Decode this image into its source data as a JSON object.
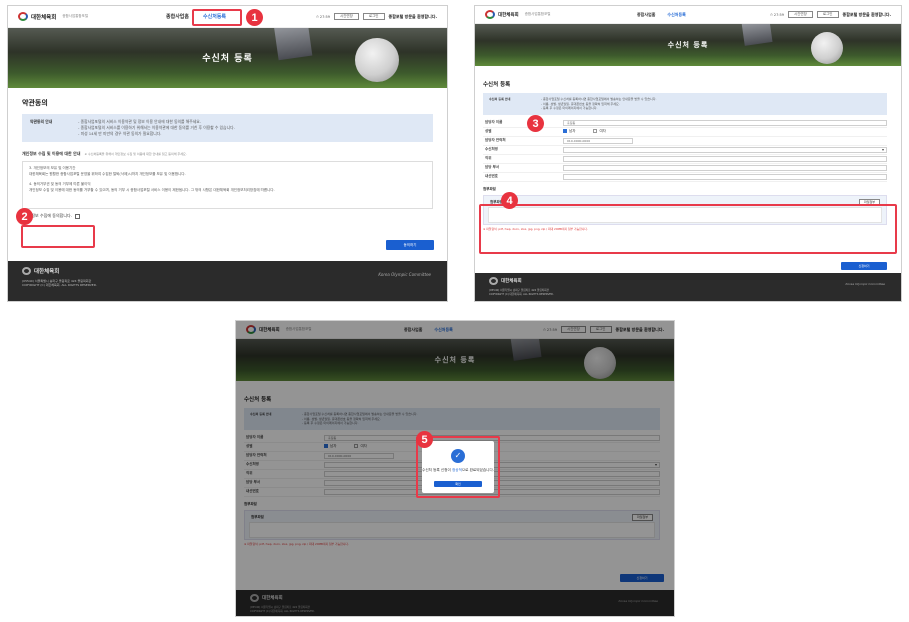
{
  "common": {
    "logo_text": "대한체육회",
    "logo_sub": "종합사업통합포털",
    "nav": [
      "종합사업홈",
      "수신처등록"
    ],
    "util_time": "⏱ 27:59",
    "util_btn1": "시간연장",
    "util_btn2": "로그인",
    "util_greeting": "종합포털 방문을 환영합니다.",
    "hero_title": "수신처 등록",
    "footer_logo": "대한체육회",
    "footer_addr": "(05540) 서울특별시 송파구 올림픽로 424 올림픽회관",
    "footer_copy": "COPYRIGHT (C) 대한체육회. ALL RIGHTS RESERVED.",
    "footer_right": "Korea Olympic Committee"
  },
  "shot1": {
    "section_title": "약관동의",
    "info_label": "약관동의 안내",
    "info_lines": [
      "- 종합사업포털의 서비스 이용약관 및 정보 이용 안내에 대한 동의를 해주세요.",
      "- 종합사업포털의 서비스를 이용하기 위해서는 이용약관에 대한 동의를 거친 후 이용할 수 있습니다.",
      "- 미성 14세 만 미만의 경우 약관 동의가 필요합니다."
    ],
    "privacy_title": "개인정보 수집 및 이용에 대한 안내",
    "privacy_note": "※ 수신처등록을 위해서 개인정보 수집 및 이용에 대한 안내를 읽고 동의해 주세요.",
    "privacy_lines": [
      "3. 개인정보의 보유 및 이용기간",
      "대한체육회는 원활한 종합사업포털 운영을 위하여 수집한 탈퇴(삭제)시까지 개인정보를 보유 및 이용합니다.",
      "",
      "4. 동의거부권 및 동의 거부에 따른 불이익",
      "개인정보 수집 및 이용에 대한 동의를 거부할 수 있으며, 동의 거부 시 종합사업포털 서비스 이용이 제한됩니다. 그 밖의 사항은 대한체육회 개인정보처리방침에 따릅니다."
    ],
    "agree_label": "개인정보 수집에 동의합니다.",
    "next_button": "동의하기",
    "badge1": "1",
    "badge2": "2"
  },
  "shot2": {
    "section_title": "수신처 등록",
    "info_label": "수신처 등록 안내",
    "info_lines": [
      "- 종합사업포털 수신처를 등록하시면 종합사업포털에서 발송하는 안내문을 받을 수 있습니다.",
      "- 이름, 성별, 생년월일, 휴대폰번호 등을 정확히 입력해 주세요.",
      "- 등록 후 수정은 마이페이지에서 가능합니다."
    ],
    "fields": [
      {
        "label": "담당자 이름",
        "value": "홍길동"
      },
      {
        "label": "성별",
        "value": ""
      },
      {
        "label": "담당자 연락처",
        "value": "010-0000-0000"
      },
      {
        "label": "수신처명",
        "value": ""
      },
      {
        "label": "직위",
        "value": ""
      },
      {
        "label": "담당 부서",
        "value": ""
      },
      {
        "label": "내선번호",
        "value": ""
      }
    ],
    "gender_options": [
      "남자",
      "여자"
    ],
    "attach_title": "첨부파일",
    "attach_label": "첨부파일",
    "attach_button": "파일첨부",
    "attach_note": "※ 파일형식: pdf, hwp, docx, xlsx, jpg, png, zip / 최대 20MB까지 첨부 가능합니다.",
    "submit_button": "신청하기",
    "badge3": "3",
    "badge4": "4"
  },
  "shot3": {
    "modal_text_before": "수신처 등록 신청이 ",
    "modal_text_highlight": "정상적",
    "modal_text_after": "으로 완료되었습니다.",
    "modal_button": "확인",
    "badge5": "5"
  }
}
